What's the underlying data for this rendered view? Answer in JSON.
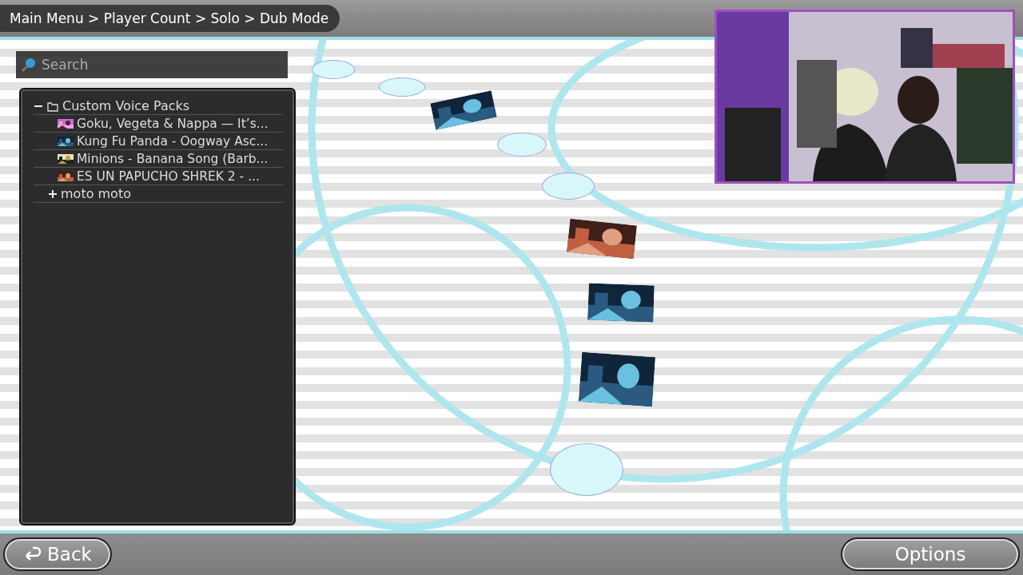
{
  "breadcrumb": "Main Menu > Player Count > Solo > Dub Mode",
  "search": {
    "placeholder": "Search"
  },
  "tree": [
    {
      "label": "Custom Voice Packs",
      "kind": "folder",
      "expanded": true,
      "children": [
        {
          "label": "Goku, Vegeta & Nappa — It’s...",
          "kind": "song"
        },
        {
          "label": "Kung Fu Panda - Oogway Asc...",
          "kind": "song"
        },
        {
          "label": "Minions - Banana Song (Barb...",
          "kind": "song"
        },
        {
          "label": "ES UN PAPUCHO SHREK 2 - ...",
          "kind": "song"
        }
      ]
    },
    {
      "label": "moto moto",
      "kind": "folder",
      "expanded": false
    }
  ],
  "buttons": {
    "back": "Back",
    "options": "Options"
  }
}
